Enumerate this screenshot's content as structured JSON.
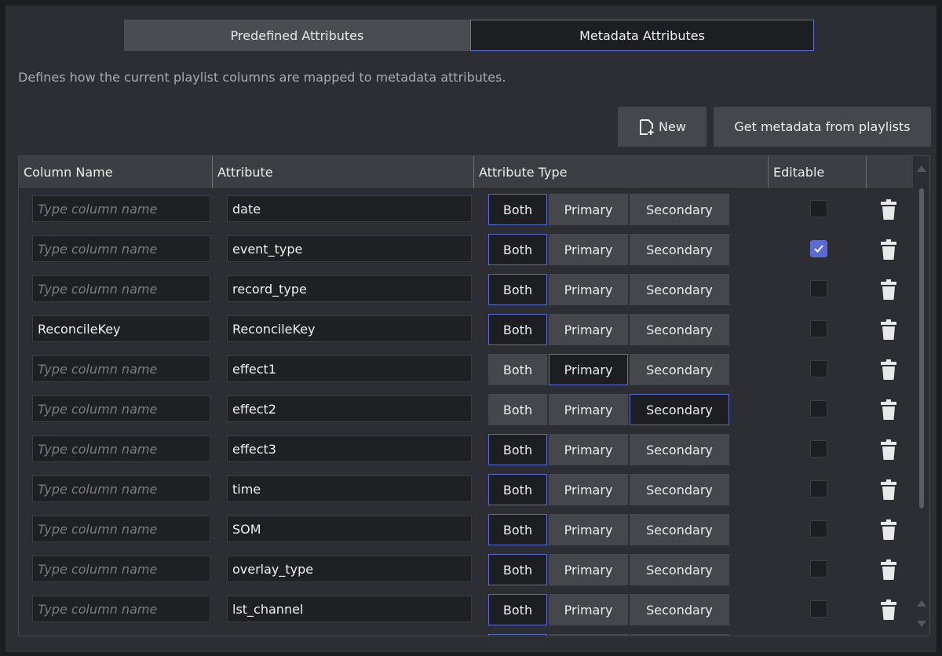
{
  "tabs": {
    "predefined": "Predefined Attributes",
    "metadata": "Metadata Attributes"
  },
  "description": "Defines how the current playlist columns are mapped to metadata attributes.",
  "toolbar": {
    "new_label": "New",
    "get_label": "Get metadata from playlists"
  },
  "table": {
    "headers": {
      "column_name": "Column Name",
      "attribute": "Attribute",
      "attribute_type": "Attribute Type",
      "editable": "Editable"
    },
    "placeholder": "Type column name",
    "type_options": {
      "both": "Both",
      "primary": "Primary",
      "secondary": "Secondary"
    },
    "rows": [
      {
        "column": "",
        "attribute": "date",
        "type": "both",
        "editable": false
      },
      {
        "column": "",
        "attribute": "event_type",
        "type": "both",
        "editable": true
      },
      {
        "column": "",
        "attribute": "record_type",
        "type": "both",
        "editable": false
      },
      {
        "column": "ReconcileKey",
        "attribute": "ReconcileKey",
        "type": "both",
        "editable": false
      },
      {
        "column": "",
        "attribute": "effect1",
        "type": "primary",
        "editable": false
      },
      {
        "column": "",
        "attribute": "effect2",
        "type": "secondary",
        "editable": false
      },
      {
        "column": "",
        "attribute": "effect3",
        "type": "both",
        "editable": false
      },
      {
        "column": "",
        "attribute": "time",
        "type": "both",
        "editable": false
      },
      {
        "column": "",
        "attribute": "SOM",
        "type": "both",
        "editable": false
      },
      {
        "column": "",
        "attribute": "overlay_type",
        "type": "both",
        "editable": false
      },
      {
        "column": "",
        "attribute": "lst_channel",
        "type": "both",
        "editable": false
      },
      {
        "column": "",
        "attribute": "",
        "type": "both",
        "editable": false
      }
    ]
  },
  "colors": {
    "accent": "#5a6bd1",
    "panel": "#2c2e33",
    "button": "#45474c"
  }
}
